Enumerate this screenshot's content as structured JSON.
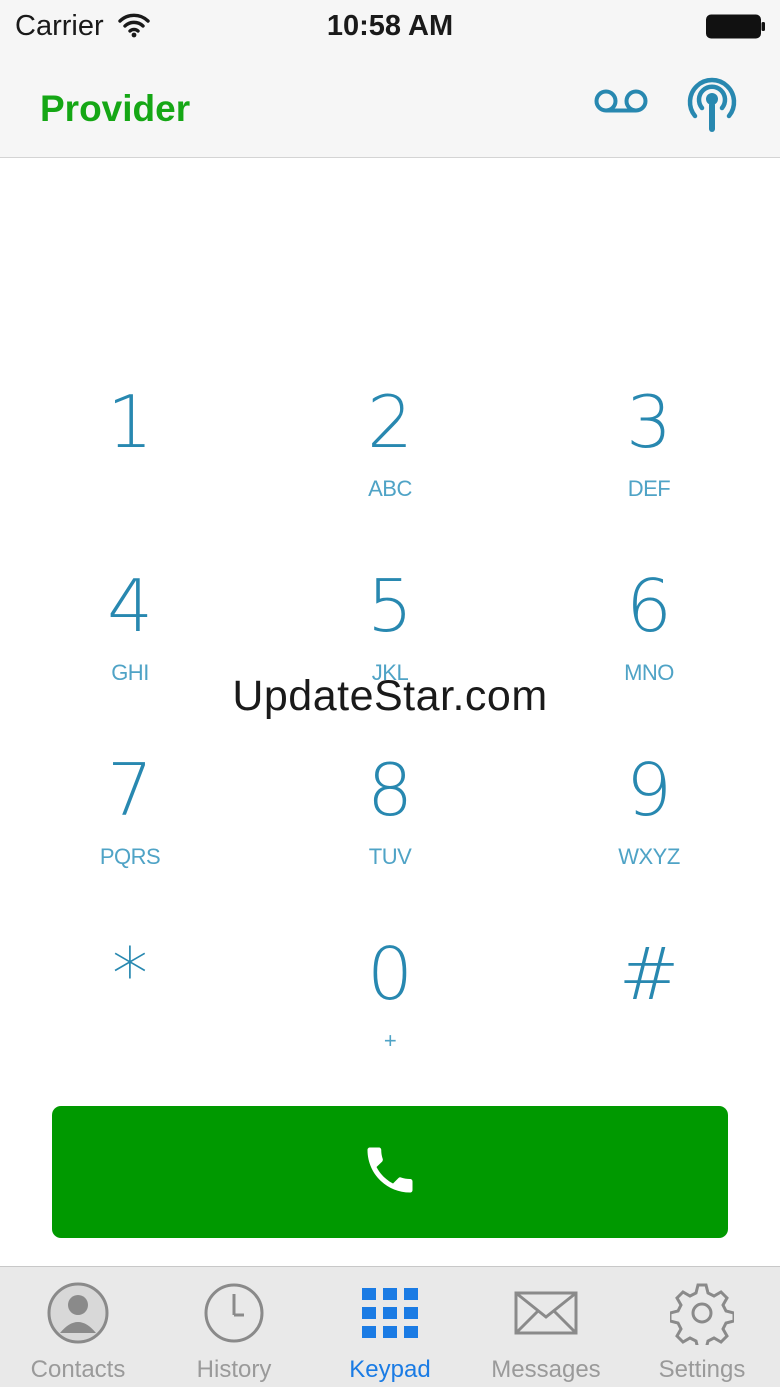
{
  "status_bar": {
    "carrier": "Carrier",
    "time": "10:58 AM",
    "icons": [
      "wifi-icon",
      "battery-icon"
    ]
  },
  "nav": {
    "title": "Provider",
    "title_color": "#15a715",
    "icons": [
      "voicemail-icon",
      "antenna-icon"
    ]
  },
  "keypad": {
    "keys": [
      {
        "digit": "1",
        "letters": ""
      },
      {
        "digit": "2",
        "letters": "ABC"
      },
      {
        "digit": "3",
        "letters": "DEF"
      },
      {
        "digit": "4",
        "letters": "GHI"
      },
      {
        "digit": "5",
        "letters": "JKL"
      },
      {
        "digit": "6",
        "letters": "MNO"
      },
      {
        "digit": "7",
        "letters": "PQRS"
      },
      {
        "digit": "8",
        "letters": "TUV"
      },
      {
        "digit": "9",
        "letters": "WXYZ"
      },
      {
        "digit": "*",
        "letters": ""
      },
      {
        "digit": "0",
        "letters": "+"
      },
      {
        "digit": "#",
        "letters": ""
      }
    ],
    "key_color": "#2888b0"
  },
  "watermark": "UpdateStar.com",
  "call_button": {
    "icon": "phone-icon",
    "color": "#009900"
  },
  "tabbar": {
    "active": "Keypad",
    "active_color": "#1a7be4",
    "tabs": [
      {
        "label": "Contacts",
        "icon": "contact-icon"
      },
      {
        "label": "History",
        "icon": "clock-icon"
      },
      {
        "label": "Keypad",
        "icon": "keypad-grid-icon"
      },
      {
        "label": "Messages",
        "icon": "envelope-icon"
      },
      {
        "label": "Settings",
        "icon": "gear-icon"
      }
    ]
  }
}
